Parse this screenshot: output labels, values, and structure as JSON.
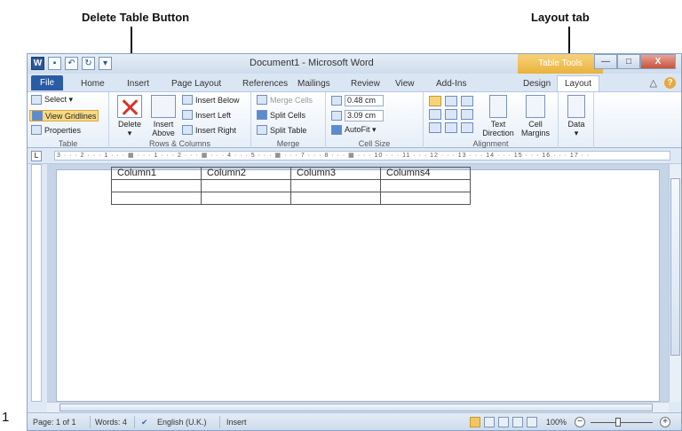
{
  "annotations": {
    "delete_table": "Delete Table Button",
    "layout_tab": "Layout tab",
    "figure_number": "1"
  },
  "window": {
    "title": "Document1 - Microsoft Word",
    "context_tab": "Table Tools",
    "minimize": "—",
    "maximize": "□",
    "close": "X"
  },
  "qat": {
    "word": "W",
    "save": "▪",
    "undo": "↶",
    "redo": "↻",
    "customize": "▾"
  },
  "tabs": [
    "File",
    "Home",
    "Insert",
    "Page Layout",
    "References",
    "Mailings",
    "Review",
    "View",
    "Add-Ins",
    "Design",
    "Layout"
  ],
  "help": {
    "minimize_ribbon": "△",
    "help": "?"
  },
  "ribbon": {
    "table": {
      "select": "Select ▾",
      "view_gridlines": "View Gridlines",
      "properties": "Properties",
      "label": "Table"
    },
    "rows_columns": {
      "delete": "Delete",
      "delete_arrow": "▾",
      "insert_above_line1": "Insert",
      "insert_above_line2": "Above",
      "insert_below": "Insert Below",
      "insert_left": "Insert Left",
      "insert_right": "Insert Right",
      "label": "Rows & Columns"
    },
    "merge": {
      "merge_cells": "Merge Cells",
      "split_cells": "Split Cells",
      "split_table": "Split Table",
      "label": "Merge"
    },
    "cell_size": {
      "height": "0.48 cm",
      "width": "3.09 cm",
      "autofit": "AutoFit ▾",
      "label": "Cell Size"
    },
    "alignment": {
      "text_direction_line1": "Text",
      "text_direction_line2": "Direction",
      "cell_margins_line1": "Cell",
      "cell_margins_line2": "Margins",
      "label": "Alignment"
    },
    "data": {
      "data": "Data",
      "arrow": "▾"
    }
  },
  "ruler": {
    "corner": "L",
    "markings": "3 · · · 2 · · · 1 · · · ▦ · · · 1 · · · 2 · · · ▦ · · · 4 · · · 5 · · · ▦ · · · 7 · · · 8 · · · ▦ · · · 10 · · · 11 · · · 12 · · · 13 · · · 14 · · · 15 · · · 16 · · · 17 · ·"
  },
  "document": {
    "table": [
      [
        "Column1",
        "Column2",
        "Column3",
        "Columns4"
      ],
      [
        "",
        "",
        "",
        ""
      ],
      [
        "",
        "",
        "",
        ""
      ]
    ]
  },
  "status": {
    "page": "Page: 1 of 1",
    "words": "Words: 4",
    "language": "English (U.K.)",
    "mode": "Insert",
    "zoom": "100%",
    "zoom_out": "−",
    "zoom_in": "+"
  }
}
